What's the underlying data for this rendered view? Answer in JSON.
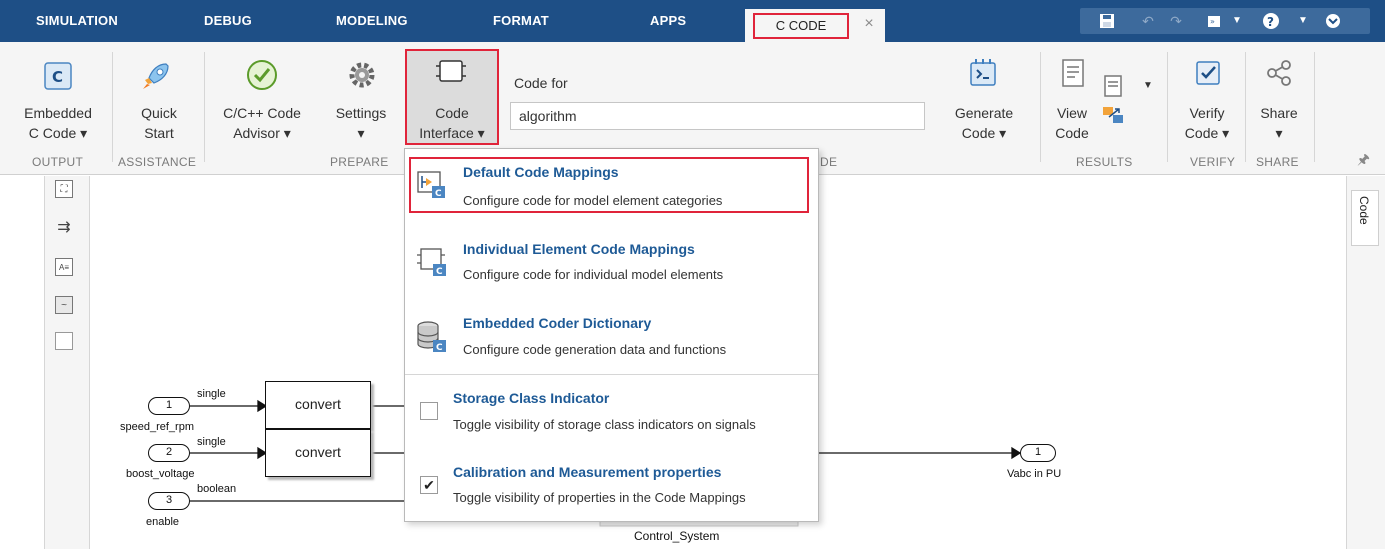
{
  "tabs": {
    "simulation": "SIMULATION",
    "debug": "DEBUG",
    "modeling": "MODELING",
    "format": "FORMAT",
    "apps": "APPS",
    "c_code": "C CODE",
    "close": "×"
  },
  "ribbon": {
    "embedded_c_code": {
      "line1": "Embedded",
      "line2": "C Code ▾"
    },
    "quick_start": {
      "line1": "Quick",
      "line2": "Start"
    },
    "advisor": {
      "line1": "C/C++ Code",
      "line2": "Advisor ▾"
    },
    "settings": {
      "line1": "Settings",
      "line2": "▾"
    },
    "code_interface": {
      "line1": "Code",
      "line2": "Interface ▾"
    },
    "code_for_label": "Code for",
    "code_for_value": "algorithm",
    "generate_code": {
      "line1": "Generate",
      "line2": "Code ▾"
    },
    "view_code": {
      "line1": "View",
      "line2": "Code"
    },
    "verify_code": {
      "line1": "Verify",
      "line2": "Code ▾"
    },
    "share": {
      "line1": "Share",
      "line2": "▾"
    },
    "sections": {
      "output": "OUTPUT",
      "assistance": "ASSISTANCE",
      "prepare": "PREPARE",
      "code_partial": "DE",
      "results": "RESULTS",
      "verify": "VERIFY",
      "share": "SHARE"
    }
  },
  "menu": {
    "items": [
      {
        "title": "Default Code Mappings",
        "desc": "Configure code for model element categories"
      },
      {
        "title": "Individual Element Code Mappings",
        "desc": "Configure code for individual model elements"
      },
      {
        "title": "Embedded Coder Dictionary",
        "desc": "Configure code generation data and functions"
      },
      {
        "title": "Storage Class Indicator",
        "desc": "Toggle visibility of storage class indicators on signals",
        "checked": false
      },
      {
        "title": "Calibration and Measurement properties",
        "desc": "Toggle visibility of properties in the Code Mappings",
        "checked": true,
        "check_glyph": "✔"
      }
    ]
  },
  "right_panel": {
    "tab_label": "Code"
  },
  "diagram": {
    "inports": [
      {
        "num": "1",
        "name": "speed_ref_rpm",
        "type": "single"
      },
      {
        "num": "2",
        "name": "boost_voltage",
        "type": "single"
      },
      {
        "num": "3",
        "name": "enable",
        "type": "boolean"
      }
    ],
    "blocks": [
      {
        "label": "convert"
      },
      {
        "label": "convert"
      }
    ],
    "outport": {
      "num": "1",
      "name": "Vabc in PU"
    },
    "subsystem_label": "Control_System"
  },
  "colors": {
    "accent": "#1e4f86",
    "highlight": "#e0243a",
    "link": "#1e5a96"
  }
}
